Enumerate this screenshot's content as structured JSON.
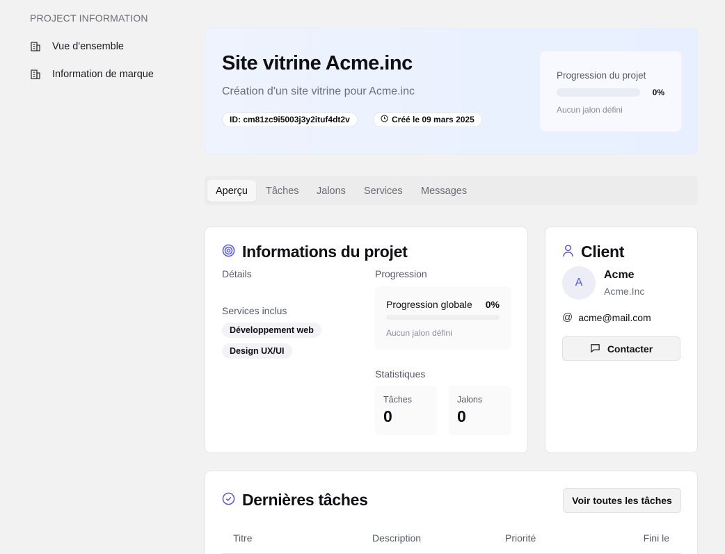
{
  "sidebar": {
    "title": "PROJECT INFORMATION",
    "items": [
      {
        "label": "Vue d'ensemble",
        "icon": "building-icon"
      },
      {
        "label": "Information de marque",
        "icon": "building-icon"
      }
    ]
  },
  "hero": {
    "title": "Site vitrine Acme.inc",
    "subtitle": "Création d'un site vitrine pour Acme.inc",
    "id_label": "ID: cm81zc9i5003j3y2ituf4dt2v",
    "created_label": "Créé le 09 mars 2025",
    "progress": {
      "label": "Progression du projet",
      "value": 0,
      "pct_label": "0%",
      "note": "Aucun jalon défini"
    }
  },
  "tabs": [
    {
      "label": "Aperçu",
      "active": true
    },
    {
      "label": "Tâches",
      "active": false
    },
    {
      "label": "Jalons",
      "active": false
    },
    {
      "label": "Services",
      "active": false
    },
    {
      "label": "Messages",
      "active": false
    }
  ],
  "project_info": {
    "title": "Informations du projet",
    "details_label": "Détails",
    "services_label": "Services inclus",
    "services": [
      "Développement web",
      "Design UX/UI"
    ],
    "progress_label": "Progression",
    "global_label": "Progression globale",
    "global_pct": "0%",
    "global_value": 0,
    "global_note": "Aucun jalon défini",
    "stats_label": "Statistiques",
    "stats": [
      {
        "label": "Tâches",
        "value": "0"
      },
      {
        "label": "Jalons",
        "value": "0"
      }
    ]
  },
  "client": {
    "title": "Client",
    "avatar_initial": "A",
    "name": "Acme",
    "company": "Acme.Inc",
    "email": "acme@mail.com",
    "contact_label": "Contacter"
  },
  "tasks": {
    "title": "Dernières tâches",
    "view_all_label": "Voir toutes les tâches",
    "columns": [
      "Titre",
      "Description",
      "Priorité",
      "Fini le"
    ]
  },
  "colors": {
    "accent": "#5b5bd6",
    "background": "#f2f2f2"
  }
}
